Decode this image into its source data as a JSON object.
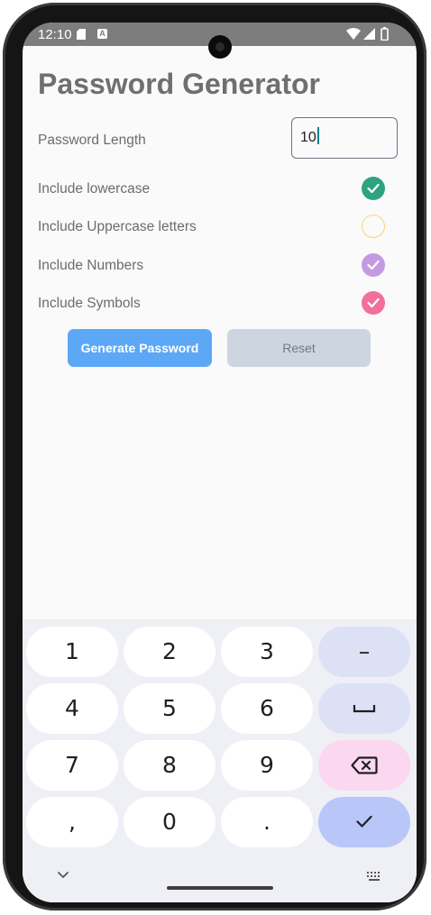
{
  "status_bar": {
    "time": "12:10",
    "notification_glyph": "A"
  },
  "app": {
    "title": "Password Generator",
    "length_label": "Password Length",
    "length_value": "10",
    "options": [
      {
        "label": "Include lowercase",
        "checked": true,
        "color": "#2ea37f"
      },
      {
        "label": "Include Uppercase letters",
        "checked": false,
        "color": "#f7d77a"
      },
      {
        "label": "Include Numbers",
        "checked": true,
        "color": "#c59ae0"
      },
      {
        "label": "Include Symbols",
        "checked": true,
        "color": "#f36f9b"
      }
    ],
    "generate_label": "Generate Password",
    "reset_label": "Reset"
  },
  "keyboard": {
    "keys": [
      "1",
      "2",
      "3",
      "4",
      "5",
      "6",
      "7",
      "8",
      "9",
      ",",
      "0",
      "."
    ],
    "minus_label": "–",
    "func_keys": [
      "space-icon",
      "backspace-icon",
      "checkmark-icon"
    ]
  },
  "colors": {
    "accent_blue": "#5ca8f7",
    "reset_bg": "#cdd5e0",
    "key_done": "#b8c7f8",
    "key_backspace": "#fbd7f0"
  }
}
